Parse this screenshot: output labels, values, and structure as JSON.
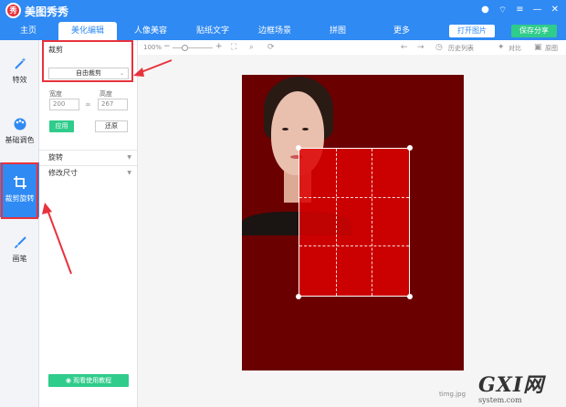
{
  "app": {
    "logo_glyph": "秀",
    "title": "美图秀秀"
  },
  "tabs": [
    "主页",
    "美化编辑",
    "人像美容",
    "贴纸文字",
    "边框场景",
    "拼图",
    "更多"
  ],
  "active_tab": "美化编辑",
  "header_buttons": {
    "open": "打开图片",
    "save": "保存分享"
  },
  "sidebar": {
    "items": [
      {
        "label": "特效",
        "icon": "magic-wand-icon"
      },
      {
        "label": "基础调色",
        "icon": "palette-icon"
      },
      {
        "label": "裁剪旋转",
        "icon": "crop-icon"
      },
      {
        "label": "画笔",
        "icon": "brush-icon"
      }
    ],
    "active": "裁剪旋转"
  },
  "panel": {
    "crop_label": "裁剪",
    "crop_mode": "自由裁剪",
    "width_label": "宽度",
    "height_label": "高度",
    "width_value": "200",
    "height_value": "267",
    "apply": "应用",
    "restore": "还原",
    "rotate": "旋转",
    "resize": "修改尺寸",
    "tutorial": "观看使用教程"
  },
  "canvas_toolbar": {
    "zoom": "100%",
    "history": "历史列表",
    "compare": "对比",
    "original": "原图"
  },
  "canvas": {
    "filename": "timg.jpg"
  },
  "watermark": {
    "main": "GXI网",
    "sub": "system.com"
  },
  "colors": {
    "brand": "#2f8af3",
    "accent_green": "#2fcc8b",
    "annotation": "#e8323c"
  }
}
